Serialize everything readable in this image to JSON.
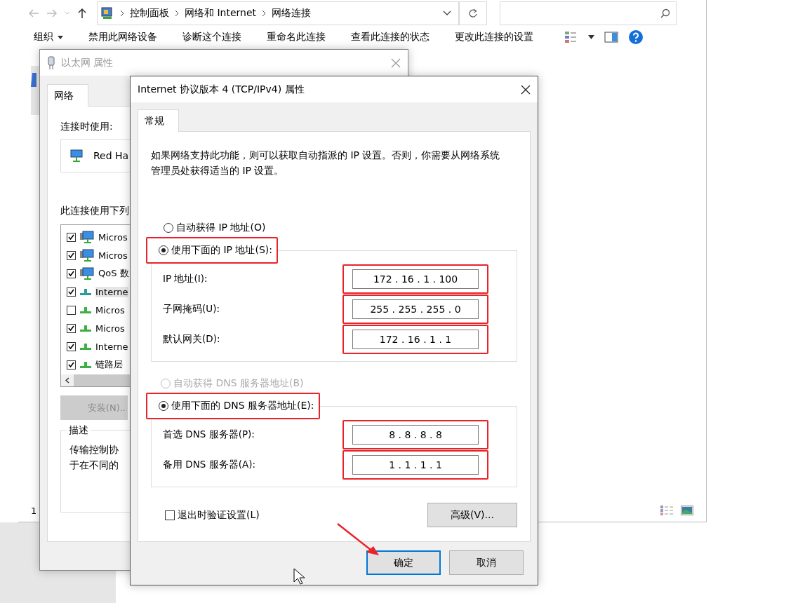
{
  "explorer": {
    "path": [
      "控制面板",
      "网络和 Internet",
      "网络连接"
    ],
    "toolbar": [
      {
        "label": "组织",
        "kind": "menu"
      },
      {
        "label": "禁用此网络设备",
        "kind": "command"
      },
      {
        "label": "诊断这个连接",
        "kind": "command"
      },
      {
        "label": "重命名此连接",
        "kind": "command"
      },
      {
        "label": "查看此连接的状态",
        "kind": "command"
      },
      {
        "label": "更改此连接的设置",
        "kind": "command"
      }
    ],
    "status_text": "1"
  },
  "ethernet_dialog": {
    "title": "以太网 属性",
    "tabs": [
      {
        "label": "网络",
        "selected": true
      }
    ],
    "connect_using_label": "连接时使用:",
    "adapter": "Red Ha",
    "components_label": "此连接使用下列",
    "components": [
      {
        "label": "Micros",
        "checked": true,
        "kind": "service",
        "selected": false
      },
      {
        "label": "Micros",
        "checked": true,
        "kind": "service",
        "selected": false
      },
      {
        "label": "QoS 数",
        "checked": true,
        "kind": "service",
        "selected": false
      },
      {
        "label": "Interne",
        "checked": true,
        "kind": "protocol",
        "selected": true
      },
      {
        "label": "Micros",
        "checked": false,
        "kind": "protocol",
        "selected": false
      },
      {
        "label": "Micros",
        "checked": true,
        "kind": "protocol",
        "selected": false
      },
      {
        "label": "Interne",
        "checked": true,
        "kind": "protocol",
        "selected": false
      },
      {
        "label": "链路层",
        "checked": true,
        "kind": "protocol",
        "selected": false
      }
    ],
    "install_button": {
      "label": "安装(N)..",
      "disabled": true
    },
    "description_title": "描述",
    "description_lines": [
      "传输控制协",
      "于在不同的"
    ]
  },
  "ipv4_dialog": {
    "title": "Internet 协议版本 4 (TCP/IPv4) 属性",
    "tabs": [
      {
        "label": "常规",
        "selected": true
      }
    ],
    "intro": "如果网络支持此功能，则可以获取自动指派的 IP 设置。否则，你需要从网络系统管理员处获得适当的 IP 设置。",
    "auto_ip": {
      "label": "自动获得 IP 地址(O)",
      "selected": false,
      "disabled": false,
      "highlighted": false
    },
    "manual_ip": {
      "label": "使用下面的 IP 地址(S):",
      "selected": true,
      "disabled": false,
      "highlighted": true
    },
    "ip_fields": [
      {
        "label": "IP 地址(I):",
        "value": "172 . 16 . 1 . 100",
        "highlighted": true
      },
      {
        "label": "子网掩码(U):",
        "value": "255 . 255 . 255 . 0",
        "highlighted": true
      },
      {
        "label": "默认网关(D):",
        "value": "172 . 16 . 1 . 1",
        "highlighted": true
      }
    ],
    "auto_dns": {
      "label": "自动获得 DNS 服务器地址(B)",
      "selected": false,
      "disabled": true,
      "highlighted": false
    },
    "manual_dns": {
      "label": "使用下面的 DNS 服务器地址(E):",
      "selected": true,
      "disabled": false,
      "highlighted": true
    },
    "dns_fields": [
      {
        "label": "首选 DNS 服务器(P):",
        "value": "8 . 8 . 8 . 8",
        "highlighted": true
      },
      {
        "label": "备用 DNS 服务器(A):",
        "value": "1 . 1 . 1 . 1",
        "highlighted": true
      }
    ],
    "validate": {
      "label": "退出时验证设置(L)",
      "checked": false
    },
    "advanced_button": "高级(V)...",
    "buttons": [
      {
        "label": "确定",
        "default": true
      },
      {
        "label": "取消",
        "default": false
      }
    ]
  }
}
